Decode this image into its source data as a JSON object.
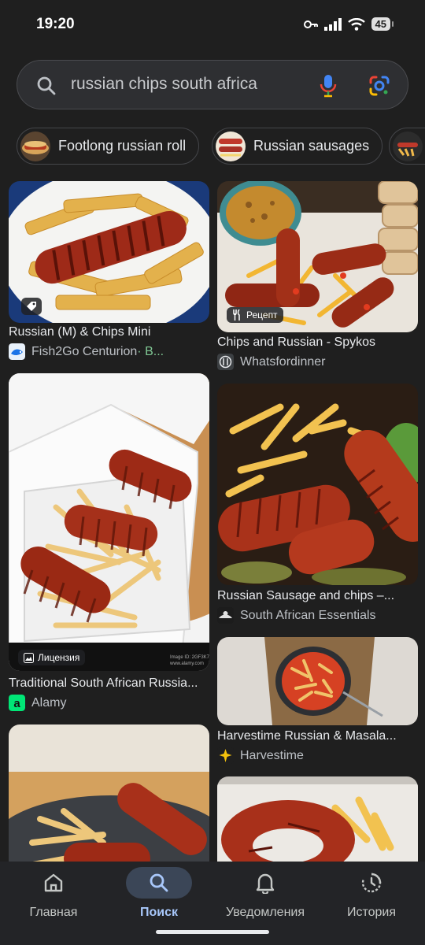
{
  "status": {
    "time": "19:20",
    "battery": "45"
  },
  "search": {
    "query": "russian chips south africa"
  },
  "chips": [
    {
      "label": "Footlong russian roll"
    },
    {
      "label": "Russian sausages"
    },
    {
      "label": ""
    }
  ],
  "results_left": [
    {
      "title": "Russian (M) & Chips Mini",
      "source": "Fish2Go Centurion",
      "extra": " · B..."
    },
    {
      "title": "Traditional South African Russia...",
      "source": "Alamy",
      "badge": "Лицензия"
    },
    {
      "title": "",
      "source": ""
    }
  ],
  "results_right": [
    {
      "title": "Chips and Russian - Spykos",
      "source": "Whatsfordinner",
      "badge": "Рецепт"
    },
    {
      "title": "Russian Sausage and chips –...",
      "source": "South African Essentials"
    },
    {
      "title": "Harvestime Russian & Masala...",
      "source": "Harvestime"
    },
    {
      "title": "",
      "source": ""
    }
  ],
  "nav": {
    "home": "Главная",
    "search": "Поиск",
    "notifications": "Уведомления",
    "history": "История"
  },
  "colors": {
    "background": "#1f1f1f",
    "accent": "#a8c7fa",
    "active_pill": "#3b4657"
  }
}
